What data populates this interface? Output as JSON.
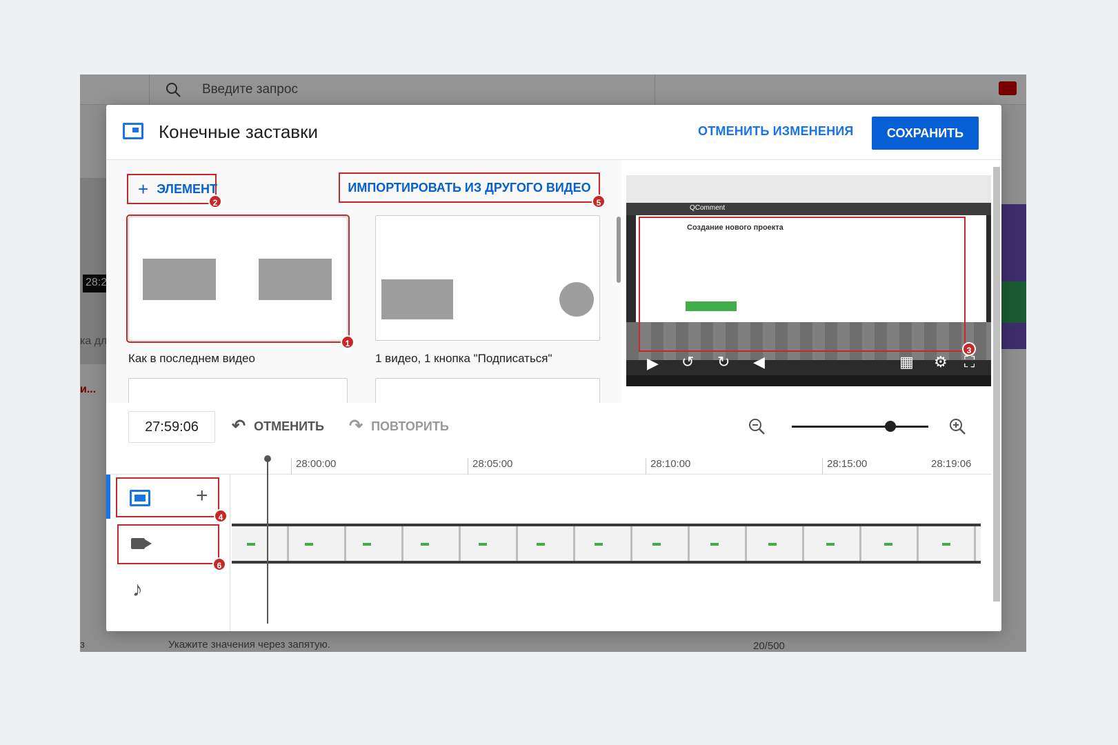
{
  "background": {
    "search_placeholder": "Введите запрос",
    "time_badge": "28:2",
    "left_text_1": "ка дл",
    "left_text_2": "и...",
    "hint": "Укажите значения через запятую.",
    "counter": "20/500",
    "bottom_left_char": "з"
  },
  "header": {
    "title": "Конечные заставки",
    "discard_label": "ОТМЕНИТЬ ИЗМЕНЕНИЯ",
    "save_label": "СОХРАНИТЬ"
  },
  "panel": {
    "add_element_label": "ЭЛЕМЕНТ",
    "import_label": "ИМПОРТИРОВАТЬ ИЗ ДРУГОГО ВИДЕО",
    "templates": [
      {
        "label": "Как в последнем видео"
      },
      {
        "label": "1 видео, 1 кнопка \"Подписаться\""
      }
    ]
  },
  "preview": {
    "site_brand": "QComment",
    "page_heading": "Создание нового проекта"
  },
  "badges": {
    "b1": "1",
    "b2": "2",
    "b3": "3",
    "b4": "4",
    "b5": "5",
    "b6": "6"
  },
  "toolbar": {
    "time": "27:59:06",
    "undo_label": "ОТМЕНИТЬ",
    "redo_label": "ПОВТОРИТЬ",
    "zoom_level": 0.72
  },
  "timeline": {
    "ticks": [
      "28:00:00",
      "28:05:00",
      "28:10:00",
      "28:15:00",
      "28:19:06"
    ]
  },
  "colors": {
    "accent": "#065fd4",
    "annotation": "#c62828"
  }
}
